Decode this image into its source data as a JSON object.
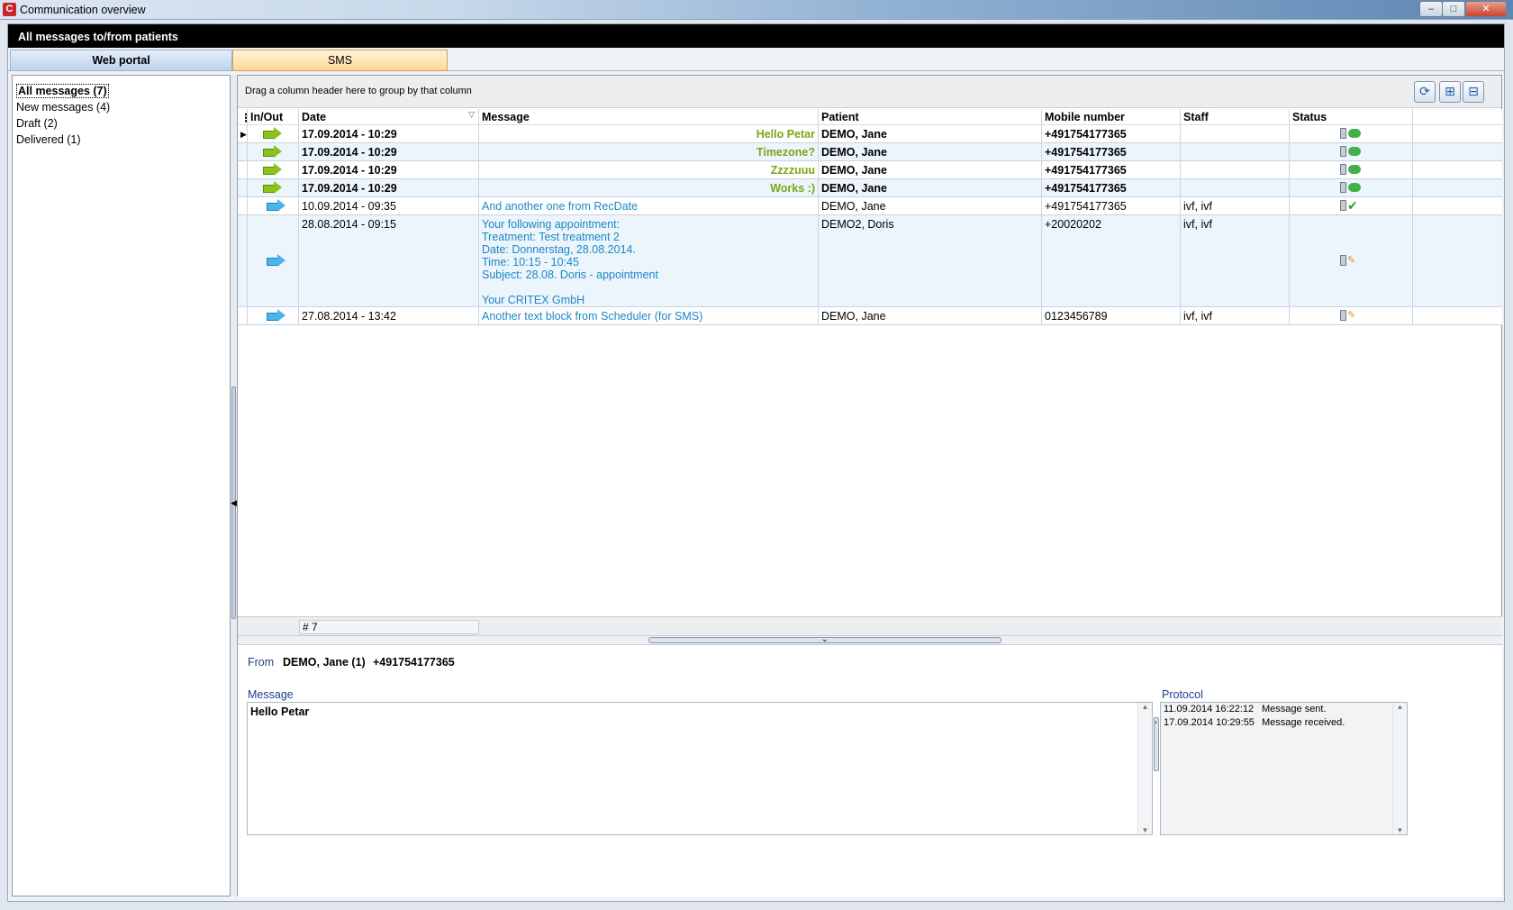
{
  "window": {
    "title": "Communication overview",
    "minimize": "–",
    "maximize": "□",
    "close": "✕"
  },
  "header": {
    "title": "All messages to/from patients"
  },
  "tabs": [
    {
      "label": "Web portal"
    },
    {
      "label": "SMS"
    }
  ],
  "folders": [
    {
      "label": "All messages (7)"
    },
    {
      "label": "New messages (4)"
    },
    {
      "label": "Draft (2)"
    },
    {
      "label": "Delivered (1)"
    }
  ],
  "grid": {
    "group_hint": "Drag a column header here to group by that column",
    "columns": {
      "io": "In/Out",
      "date": "Date",
      "message": "Message",
      "patient": "Patient",
      "mobile": "Mobile number",
      "staff": "Staff",
      "status": "Status"
    },
    "rows": [
      {
        "date": "17.09.2014 - 10:29",
        "message": "Hello Petar",
        "patient": "DEMO, Jane",
        "mobile": "+491754177365",
        "staff": ""
      },
      {
        "date": "17.09.2014 - 10:29",
        "message": "Timezone?",
        "patient": "DEMO, Jane",
        "mobile": "+491754177365",
        "staff": ""
      },
      {
        "date": "17.09.2014 - 10:29",
        "message": "Zzzzuuu",
        "patient": "DEMO, Jane",
        "mobile": "+491754177365",
        "staff": ""
      },
      {
        "date": "17.09.2014 - 10:29",
        "message": "Works :)",
        "patient": "DEMO, Jane",
        "mobile": "+491754177365",
        "staff": ""
      },
      {
        "date": "10.09.2014 - 09:35",
        "message": "And another one from RecDate",
        "patient": "DEMO, Jane",
        "mobile": "+491754177365",
        "staff": "ivf, ivf"
      },
      {
        "date": "28.08.2014 - 09:15",
        "message": "Your following appointment:\nTreatment: Test treatment 2\nDate: Donnerstag, 28.08.2014.\nTime: 10:15 - 10:45\nSubject: 28.08. Doris - appointment\n\nYour CRITEX GmbH",
        "patient": "DEMO2, Doris",
        "mobile": "+20020202",
        "staff": "ivf, ivf"
      },
      {
        "date": "27.08.2014 - 13:42",
        "message": "Another text block from Scheduler (for SMS)",
        "patient": "DEMO, Jane",
        "mobile": "0123456789",
        "staff": "ivf, ivf"
      }
    ],
    "count": "# 7"
  },
  "detail": {
    "from_label": "From",
    "from_name": "DEMO, Jane (1)",
    "from_phone": "+491754177365",
    "message_label": "Message",
    "message_text": "Hello Petar",
    "protocol_label": "Protocol",
    "protocol": [
      {
        "time": "11.09.2014 16:22:12",
        "text": "Message sent."
      },
      {
        "time": "17.09.2014 10:29:55",
        "text": "Message received."
      }
    ]
  },
  "icons": {
    "incoming": "incoming-arrow-icon",
    "outgoing": "outgoing-arrow-icon",
    "refresh": "refresh-icon",
    "expand": "expand-all-icon",
    "collapse": "collapse-all-icon"
  },
  "colors": {
    "incoming_text": "#7aa616",
    "outgoing_text": "#1c88c4",
    "header_bg": "#000000",
    "active_tab": "#ffd79a"
  }
}
